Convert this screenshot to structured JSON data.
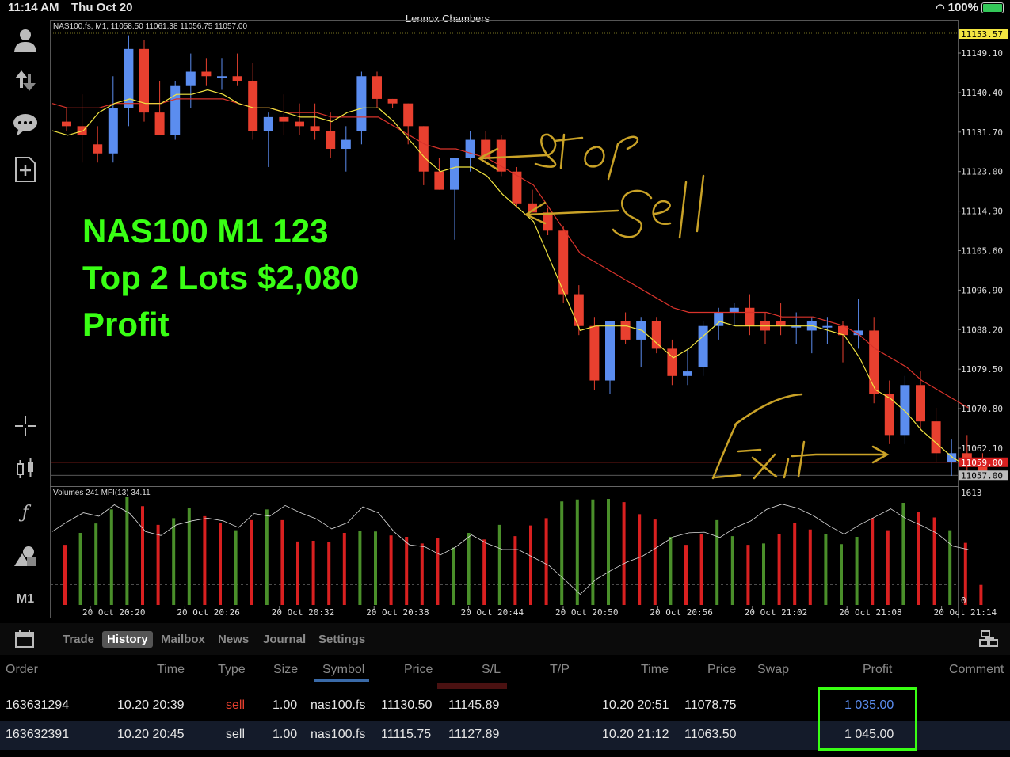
{
  "status": {
    "time": "11:14 AM",
    "date": "Thu Oct 20",
    "battery": "100%"
  },
  "account_name": "Lennox Chambers",
  "chart": {
    "info_line": "NAS100.fs, M1, 11058.50 11061.38 11056.75 11057.00",
    "overlay": [
      "NAS100 M1 123",
      "Top 2 Lots $2,080",
      "Profit"
    ],
    "handwritten_labels": [
      "Stop",
      "Sell",
      "Exit"
    ],
    "volume_info": "Volumes 241 MFI(13) 34.11",
    "volume_max_label": "1613",
    "volume_min_label": "0",
    "timeframe_label": "M1",
    "colors": {
      "up": "#5b8def",
      "down": "#e8402f",
      "fast_ma": "#f2e541",
      "slow_ma": "#d9332b",
      "vol_up": "#4a8f2a",
      "vol_down": "#d92020",
      "annotation": "#c9a227",
      "overlay_text": "#39ff14"
    }
  },
  "chart_data": {
    "type": "candlestick",
    "price_ticks": [
      11149.1,
      11140.4,
      11131.7,
      11123.0,
      11114.3,
      11105.6,
      11096.9,
      11088.2,
      11079.5,
      11070.8,
      11062.1
    ],
    "price_tick_labels": [
      "11149.10",
      "11140.40",
      "11131.70",
      "11123.00",
      "11114.30",
      "11105.60",
      "11096.90",
      "11088.20",
      "11079.50",
      "11070.80",
      "11062.10"
    ],
    "top_price_label": "11153.57",
    "bid_label": "11059.00",
    "last_label": "11057.00",
    "ylim": [
      11055,
      11153.6
    ],
    "time_labels": [
      "20 Oct 20:20",
      "20 Oct 20:26",
      "20 Oct 20:32",
      "20 Oct 20:38",
      "20 Oct 20:44",
      "20 Oct 20:50",
      "20 Oct 20:56",
      "20 Oct 21:02",
      "20 Oct 21:08",
      "20 Oct 21:14"
    ],
    "candles": [
      {
        "o": 11134,
        "h": 11137,
        "l": 11132,
        "c": 11133
      },
      {
        "o": 11133,
        "h": 11140,
        "l": 11125,
        "c": 11131
      },
      {
        "o": 11129,
        "h": 11133,
        "l": 11125,
        "c": 11127
      },
      {
        "o": 11127,
        "h": 11144,
        "l": 11125,
        "c": 11137
      },
      {
        "o": 11137,
        "h": 11153,
        "l": 11133,
        "c": 11150
      },
      {
        "o": 11150,
        "h": 11152,
        "l": 11134,
        "c": 11136
      },
      {
        "o": 11136,
        "h": 11143,
        "l": 11131,
        "c": 11131
      },
      {
        "o": 11131,
        "h": 11143,
        "l": 11130,
        "c": 11142
      },
      {
        "o": 11142,
        "h": 11149,
        "l": 11137,
        "c": 11145
      },
      {
        "o": 11145,
        "h": 11148,
        "l": 11142,
        "c": 11144
      },
      {
        "o": 11144,
        "h": 11148,
        "l": 11141,
        "c": 11144
      },
      {
        "o": 11144,
        "h": 11149,
        "l": 11142,
        "c": 11143
      },
      {
        "o": 11143,
        "h": 11147,
        "l": 11130,
        "c": 11132
      },
      {
        "o": 11132,
        "h": 11136,
        "l": 11124,
        "c": 11135
      },
      {
        "o": 11135,
        "h": 11140,
        "l": 11131,
        "c": 11134
      },
      {
        "o": 11134,
        "h": 11138,
        "l": 11131,
        "c": 11133
      },
      {
        "o": 11133,
        "h": 11138,
        "l": 11130,
        "c": 11132
      },
      {
        "o": 11132,
        "h": 11136,
        "l": 11126,
        "c": 11128
      },
      {
        "o": 11128,
        "h": 11133,
        "l": 11123,
        "c": 11130
      },
      {
        "o": 11132,
        "h": 11145,
        "l": 11129,
        "c": 11144
      },
      {
        "o": 11144,
        "h": 11145,
        "l": 11137,
        "c": 11139
      },
      {
        "o": 11139,
        "h": 11139,
        "l": 11137,
        "c": 11138
      },
      {
        "o": 11138,
        "h": 11138,
        "l": 11129,
        "c": 11133
      },
      {
        "o": 11133,
        "h": 11133,
        "l": 11120,
        "c": 11123
      },
      {
        "o": 11123,
        "h": 11126,
        "l": 11119,
        "c": 11119
      },
      {
        "o": 11119,
        "h": 11125,
        "l": 11108,
        "c": 11126
      },
      {
        "o": 11126,
        "h": 11132,
        "l": 11123,
        "c": 11130
      },
      {
        "o": 11130,
        "h": 11132,
        "l": 11125,
        "c": 11126
      },
      {
        "o": 11130,
        "h": 11131,
        "l": 11122,
        "c": 11123
      },
      {
        "o": 11123,
        "h": 11124,
        "l": 11115,
        "c": 11116
      },
      {
        "o": 11116,
        "h": 11119,
        "l": 11114,
        "c": 11114
      },
      {
        "o": 11114,
        "h": 11115,
        "l": 11109,
        "c": 11110
      },
      {
        "o": 11110,
        "h": 11111,
        "l": 11094,
        "c": 11096
      },
      {
        "o": 11096,
        "h": 11098,
        "l": 11087,
        "c": 11089
      },
      {
        "o": 11089,
        "h": 11091,
        "l": 11075,
        "c": 11077
      },
      {
        "o": 11077,
        "h": 11090,
        "l": 11074,
        "c": 11090
      },
      {
        "o": 11090,
        "h": 11092,
        "l": 11085,
        "c": 11086
      },
      {
        "o": 11086,
        "h": 11091,
        "l": 11080,
        "c": 11090
      },
      {
        "o": 11090,
        "h": 11091,
        "l": 11083,
        "c": 11084
      },
      {
        "o": 11084,
        "h": 11086,
        "l": 11076,
        "c": 11078
      },
      {
        "o": 11078,
        "h": 11084,
        "l": 11076,
        "c": 11079
      },
      {
        "o": 11080,
        "h": 11090,
        "l": 11078,
        "c": 11089
      },
      {
        "o": 11089,
        "h": 11093,
        "l": 11086,
        "c": 11092
      },
      {
        "o": 11092,
        "h": 11094,
        "l": 11089,
        "c": 11093
      },
      {
        "o": 11093,
        "h": 11096,
        "l": 11087,
        "c": 11089
      },
      {
        "o": 11090,
        "h": 11092,
        "l": 11085,
        "c": 11088
      },
      {
        "o": 11090,
        "h": 11094,
        "l": 11087,
        "c": 11089
      },
      {
        "o": 11089,
        "h": 11092,
        "l": 11085,
        "c": 11089
      },
      {
        "o": 11088,
        "h": 11091,
        "l": 11083,
        "c": 11090
      },
      {
        "o": 11089,
        "h": 11091,
        "l": 11085,
        "c": 11089
      },
      {
        "o": 11089,
        "h": 11090,
        "l": 11081,
        "c": 11087
      },
      {
        "o": 11087,
        "h": 11095,
        "l": 11084,
        "c": 11088
      },
      {
        "o": 11088,
        "h": 11091,
        "l": 11072,
        "c": 11074
      },
      {
        "o": 11074,
        "h": 11077,
        "l": 11063,
        "c": 11065
      },
      {
        "o": 11065,
        "h": 11078,
        "l": 11063,
        "c": 11076
      },
      {
        "o": 11076,
        "h": 11079,
        "l": 11066,
        "c": 11068
      },
      {
        "o": 11068,
        "h": 11071,
        "l": 11059,
        "c": 11061
      },
      {
        "o": 11059,
        "h": 11064,
        "l": 11056,
        "c": 11061
      },
      {
        "o": 11061,
        "h": 11065,
        "l": 11056,
        "c": 11058
      },
      {
        "o": 11058,
        "h": 11061,
        "l": 11056,
        "c": 11057
      }
    ],
    "fast_ma": [
      11132,
      11131,
      11132,
      11136,
      11138,
      11139,
      11138,
      11138,
      11140,
      11140,
      11141,
      11140,
      11138,
      11137,
      11137,
      11136,
      11135,
      11135,
      11134,
      11136,
      11137,
      11137,
      11134,
      11130,
      11126,
      11123,
      11124,
      11124,
      11122,
      11118,
      11115,
      11112,
      11104,
      11096,
      11088,
      11089,
      11089,
      11089,
      11088,
      11085,
      11082,
      11084,
      11087,
      11090,
      11089,
      11089,
      11089,
      11089,
      11089,
      11089,
      11088,
      11087,
      11082,
      11075,
      11073,
      11070,
      11066,
      11063,
      11060,
      11058
    ],
    "slow_ma": [
      11138,
      11137,
      11137,
      11137,
      11138,
      11138,
      11138,
      11138,
      11139,
      11139,
      11139,
      11139,
      11138,
      11137,
      11137,
      11136,
      11136,
      11136,
      11135,
      11135,
      11135,
      11135,
      11133,
      11131,
      11129,
      11128,
      11128,
      11127,
      11126,
      11124,
      11122,
      11120,
      11115,
      11110,
      11105,
      11103,
      11101,
      11099,
      11097,
      11095,
      11093,
      11092,
      11092,
      11092,
      11092,
      11092,
      11092,
      11091,
      11091,
      11091,
      11090,
      11089,
      11087,
      11084,
      11082,
      11080,
      11077,
      11075,
      11073,
      11071
    ],
    "volumes": [
      900,
      1080,
      1220,
      1430,
      1613,
      1480,
      1200,
      1300,
      1450,
      1330,
      1230,
      1120,
      1270,
      1430,
      1270,
      950,
      960,
      940,
      1080,
      1110,
      1100,
      1040,
      1020,
      920,
      1000,
      860,
      1080,
      980,
      1200,
      1030,
      1190,
      1300,
      1550,
      1580,
      1580,
      1590,
      1540,
      1360,
      1280,
      1020,
      900,
      1060,
      1270,
      1030,
      900,
      920,
      1060,
      1230,
      1130,
      1060,
      910,
      1020,
      1300,
      1120,
      1530,
      1390,
      1310,
      1120,
      930,
      300
    ],
    "volume_dir": [
      "d",
      "u",
      "u",
      "u",
      "u",
      "d",
      "d",
      "u",
      "u",
      "d",
      "d",
      "u",
      "d",
      "u",
      "d",
      "d",
      "d",
      "d",
      "d",
      "u",
      "u",
      "d",
      "d",
      "d",
      "d",
      "u",
      "u",
      "d",
      "u",
      "d",
      "d",
      "d",
      "u",
      "u",
      "u",
      "u",
      "d",
      "d",
      "d",
      "u",
      "d",
      "d",
      "u",
      "u",
      "d",
      "u",
      "d",
      "d",
      "d",
      "u",
      "u",
      "u",
      "d",
      "d",
      "u",
      "d",
      "d",
      "u",
      "d",
      "d"
    ],
    "mfi": [
      1100,
      1250,
      1380,
      1330,
      1500,
      1370,
      1100,
      1040,
      1200,
      1260,
      1300,
      1260,
      1160,
      1370,
      1330,
      1490,
      1380,
      1290,
      1140,
      1230,
      1470,
      1380,
      1100,
      900,
      870,
      750,
      870,
      1050,
      920,
      830,
      830,
      710,
      590,
      380,
      160,
      380,
      520,
      640,
      730,
      870,
      1020,
      1080,
      1090,
      1010,
      1160,
      1260,
      1430,
      1510,
      1450,
      1340,
      1190,
      1060,
      1200,
      1320,
      1440,
      1290,
      1190,
      1070,
      880,
      830
    ]
  },
  "tabs": {
    "trade": "Trade",
    "history": "History",
    "mailbox": "Mailbox",
    "news": "News",
    "journal": "Journal",
    "settings": "Settings"
  },
  "table": {
    "headers": {
      "order": "Order",
      "time": "Time",
      "type": "Type",
      "size": "Size",
      "symbol": "Symbol",
      "price": "Price",
      "sl": "S/L",
      "tp": "T/P",
      "time2": "Time",
      "price2": "Price",
      "swap": "Swap",
      "profit": "Profit",
      "comment": "Comment"
    },
    "rows": [
      {
        "order": "163631294",
        "time": "10.20 20:39",
        "type": "sell",
        "size": "1.00",
        "symbol": "nas100.fs",
        "price": "11130.50",
        "sl": "11145.89",
        "tp": "",
        "time2": "10.20 20:51",
        "price2": "11078.75",
        "swap": "",
        "profit": "1 035.00",
        "comment": ""
      },
      {
        "order": "163632391",
        "time": "10.20 20:45",
        "type": "sell",
        "size": "1.00",
        "symbol": "nas100.fs",
        "price": "11115.75",
        "sl": "11127.89",
        "tp": "",
        "time2": "10.20 21:12",
        "price2": "11063.50",
        "swap": "",
        "profit": "1 045.00",
        "comment": ""
      }
    ]
  }
}
